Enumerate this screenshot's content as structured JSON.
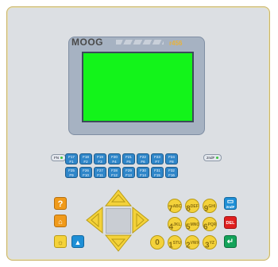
{
  "panel": {
    "brand": "MOOG",
    "model": "r456"
  },
  "screen": {
    "color": "#13f41a"
  },
  "fkeys": {
    "row1_top": [
      "F17",
      "F18",
      "F19",
      "F20",
      "F21",
      "F22",
      "F23",
      "F24"
    ],
    "row1_bottom": [
      "F1",
      "F2",
      "F3",
      "F4",
      "F5",
      "F6",
      "F7",
      "F8"
    ],
    "row2_top": [
      "F25",
      "F26",
      "F27",
      "F28",
      "F29",
      "F30",
      "F31",
      "F32"
    ],
    "row2_bottom": [
      "F9",
      "F10",
      "F11",
      "F12",
      "F13",
      "F14",
      "F15",
      "F16"
    ],
    "left_pill": "FN",
    "right_pill": "2ndF"
  },
  "left_keys": {
    "help": "?",
    "up": "▲"
  },
  "right_keys": {
    "del": "DEL",
    "second": "2ndF"
  },
  "numpad": {
    "row1": [
      "7",
      "8",
      "9"
    ],
    "row2": [
      "4",
      "5",
      "6"
    ],
    "row3": [
      "0",
      "1",
      "2",
      "3"
    ],
    "row1_sup": [
      "ABC",
      "DEF",
      "GHI"
    ],
    "row2_sup": [
      "JKL",
      "MNO",
      "PQR"
    ],
    "row3_sup": [
      "",
      "STU",
      "VWX",
      "YZ"
    ]
  }
}
